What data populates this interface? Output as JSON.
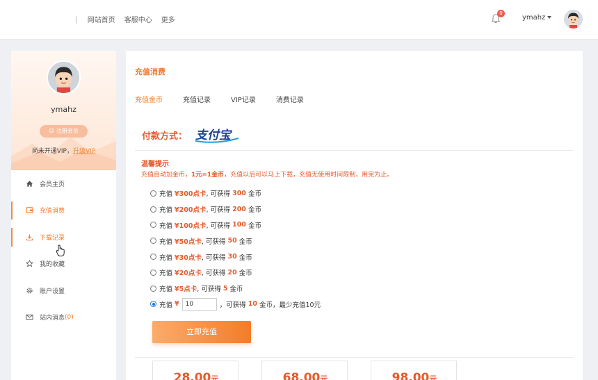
{
  "header": {
    "nav": [
      "网站首页",
      "客服中心",
      "更多"
    ],
    "separator": "|",
    "notifications": "0",
    "username": "ymahz"
  },
  "sidebar": {
    "username": "ymahz",
    "register_button": "注册会员",
    "vip_status": "尚未开通VIP，",
    "upgrade_link": "升级VIP",
    "items": [
      {
        "label": "会员主页",
        "icon": "home-icon"
      },
      {
        "label": "充值消费",
        "icon": "wallet-icon"
      },
      {
        "label": "下载记录",
        "icon": "download-icon"
      },
      {
        "label": "我的收藏",
        "icon": "star-icon"
      },
      {
        "label": "账户设置",
        "icon": "gear-icon"
      },
      {
        "label": "站内消息",
        "icon": "mail-icon"
      }
    ],
    "message_count": "(0)"
  },
  "main": {
    "title": "充值消费",
    "tabs": [
      "充值金币",
      "充值记录",
      "VIP记录",
      "消费记录"
    ],
    "pay_label": "付款方式：",
    "pay_method": "支付宝",
    "tip_title": "温馨提示",
    "tip_prefix": "充值自动加金币，",
    "tip_rate": "1元=1金币",
    "tip_suffix": "，充值以后可以马上下载，充值无使用时间限制，用完为止。",
    "options": [
      {
        "prefix": "充值",
        "card": "¥300点卡",
        "mid": ", 可获得",
        "coins": "300",
        "suffix": "金币"
      },
      {
        "prefix": "充值",
        "card": "¥200点卡",
        "mid": ", 可获得",
        "coins": "200",
        "suffix": "金币"
      },
      {
        "prefix": "充值",
        "card": "¥100点卡",
        "mid": ", 可获得",
        "coins": "100",
        "suffix": "金币"
      },
      {
        "prefix": "充值",
        "card": "¥50点卡",
        "mid": ", 可获得",
        "coins": "50",
        "suffix": "金币"
      },
      {
        "prefix": "充值",
        "card": "¥30点卡",
        "mid": ", 可获得",
        "coins": "30",
        "suffix": "金币"
      },
      {
        "prefix": "充值",
        "card": "¥20点卡",
        "mid": ", 可获得",
        "coins": "20",
        "suffix": "金币"
      },
      {
        "prefix": "充值",
        "card": "¥5点卡",
        "mid": ", 可获得",
        "coins": "5",
        "suffix": "金币"
      }
    ],
    "custom": {
      "prefix": "充值",
      "currency": "¥",
      "value": "10",
      "mid": "，可获得",
      "coins": "10",
      "suffix": "金币，最少充值10元"
    },
    "submit": "立即充值",
    "prices": [
      {
        "value": "28.00",
        "unit": "元"
      },
      {
        "value": "68.00",
        "unit": "元"
      },
      {
        "value": "98.00",
        "unit": "元"
      }
    ]
  }
}
